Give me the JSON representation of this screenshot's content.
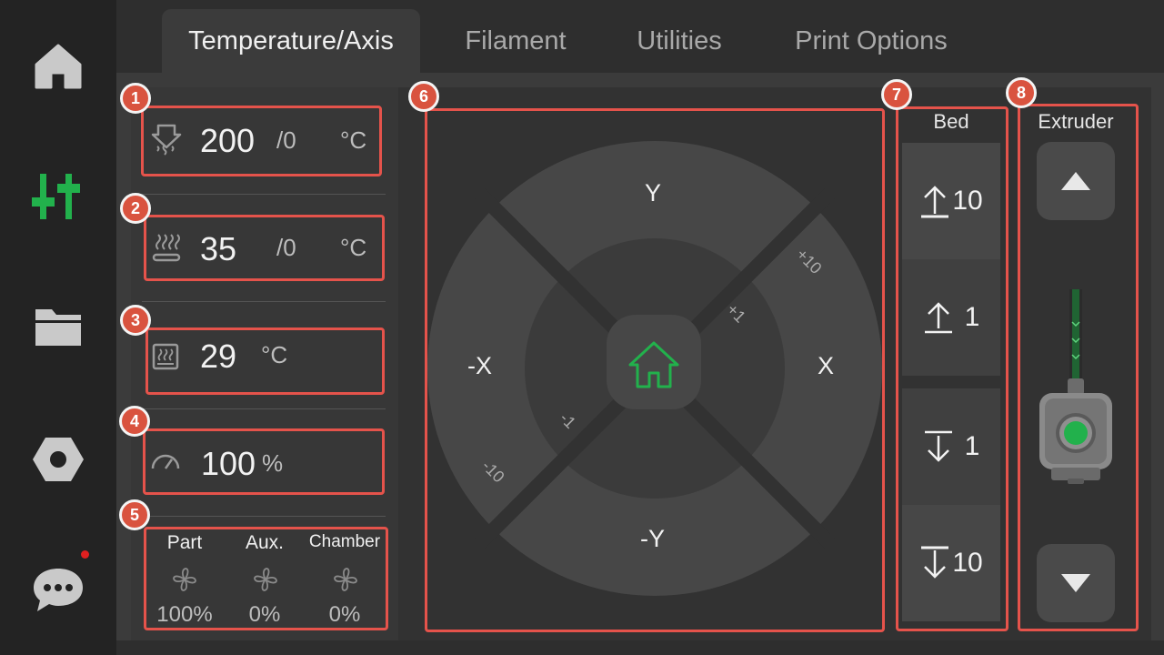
{
  "sidebar": {
    "items": [
      {
        "name": "home",
        "icon": "home-icon"
      },
      {
        "name": "controls",
        "icon": "sliders-icon",
        "active": true
      },
      {
        "name": "files",
        "icon": "folder-icon"
      },
      {
        "name": "settings",
        "icon": "hex-nut-icon"
      },
      {
        "name": "messages",
        "icon": "chat-icon",
        "has_notification": true
      }
    ]
  },
  "tabs": [
    {
      "label": "Temperature/Axis",
      "active": true
    },
    {
      "label": "Filament"
    },
    {
      "label": "Utilities"
    },
    {
      "label": "Print Options"
    }
  ],
  "badges": [
    "1",
    "2",
    "3",
    "4",
    "5",
    "6",
    "7",
    "8"
  ],
  "temperature": {
    "nozzle": {
      "current": "200",
      "target": "/0",
      "unit": "°C",
      "icon": "nozzle-heat-icon"
    },
    "bed": {
      "current": "35",
      "target": "/0",
      "unit": "°C",
      "icon": "bed-heat-icon"
    },
    "chamber": {
      "current": "29",
      "unit": "°C",
      "icon": "chamber-heat-icon"
    }
  },
  "speed": {
    "value": "100",
    "unit": "%",
    "icon": "speedometer-icon"
  },
  "fans": [
    {
      "label": "Part",
      "value": "100%"
    },
    {
      "label": "Aux.",
      "value": "0%"
    },
    {
      "label": "Chamber",
      "value": "0%"
    }
  ],
  "jog": {
    "y_plus": "Y",
    "y_minus": "-Y",
    "x_minus": "-X",
    "x_plus": "X",
    "step_small_plus": "+1",
    "step_large_plus": "+10",
    "step_small_minus": "-1",
    "step_large_minus": "-10",
    "home_icon": "home-icon"
  },
  "bed_control": {
    "title": "Bed",
    "buttons": [
      {
        "label": "10",
        "icon": "arrow-up-bar-icon"
      },
      {
        "label": "1",
        "icon": "arrow-up-bar-icon"
      },
      {
        "label": "1",
        "icon": "arrow-down-bar-icon"
      },
      {
        "label": "10",
        "icon": "arrow-down-bar-icon"
      }
    ]
  },
  "extruder": {
    "title": "Extruder",
    "up_icon": "triangle-up-icon",
    "down_icon": "triangle-down-icon"
  },
  "colors": {
    "accent": "#22b14c",
    "highlight_box": "#e5534b",
    "badge": "#d9533f"
  }
}
